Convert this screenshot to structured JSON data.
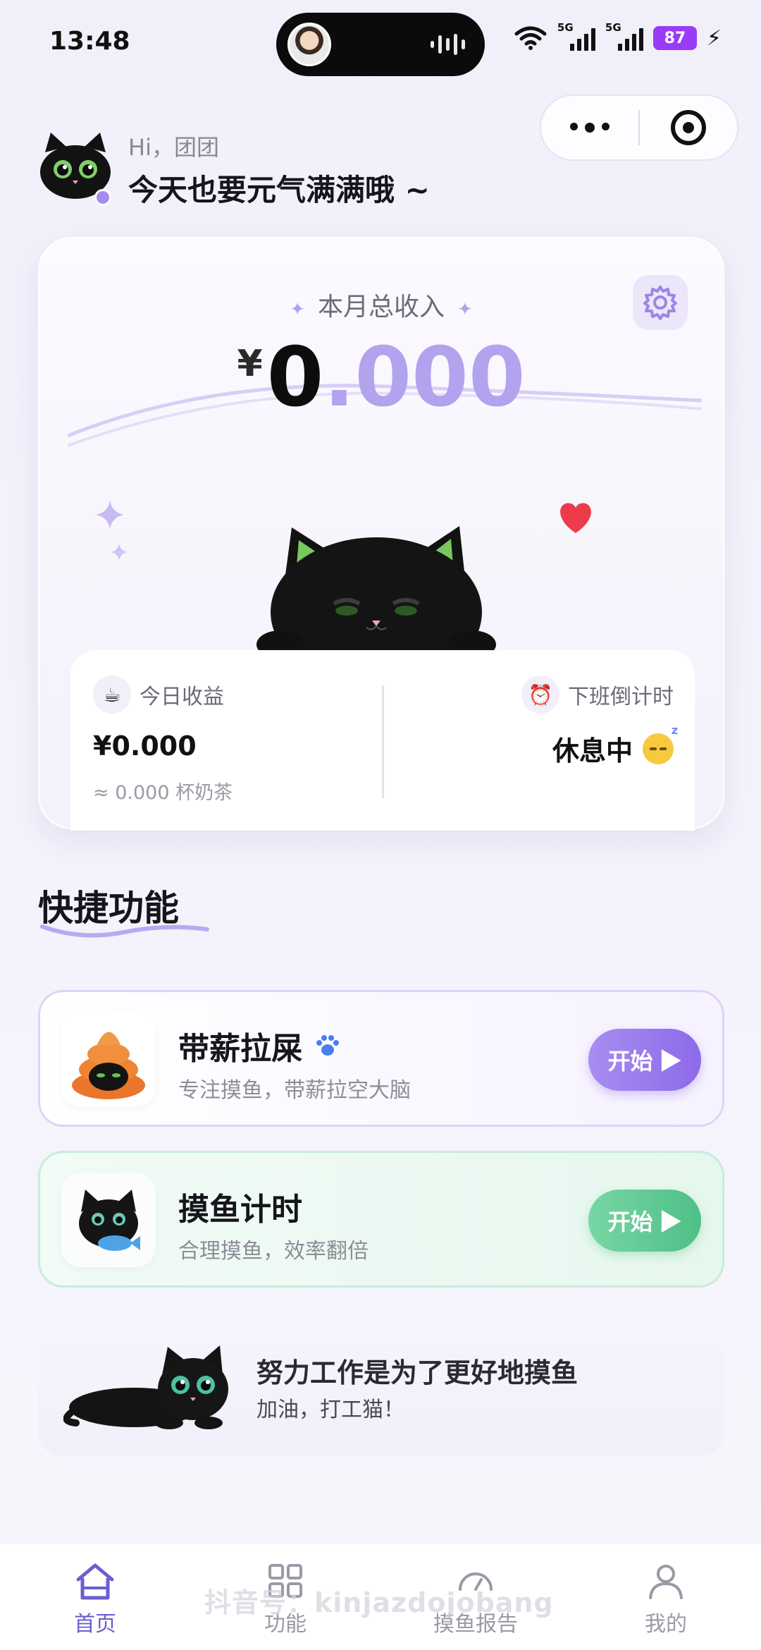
{
  "status_bar": {
    "time": "13:48",
    "network_1": "5G",
    "network_2": "5G",
    "battery": "87"
  },
  "header": {
    "hi": "Hi，团团",
    "greeting": "今天也要元气满满哦 ~"
  },
  "income_card": {
    "label": "本月总收入",
    "currency": "¥",
    "amount_int": "0",
    "amount_dec": ".000",
    "today": {
      "title": "今日收益",
      "amount": "¥0.000",
      "equiv": "≈ 0.000 杯奶茶"
    },
    "countdown": {
      "title": "下班倒计时",
      "status": "休息中"
    }
  },
  "quick": {
    "title": "快捷功能",
    "items": [
      {
        "title": "带薪拉屎",
        "subtitle": "专注摸鱼，带薪拉空大脑",
        "button": "开始 ▶"
      },
      {
        "title": "摸鱼计时",
        "subtitle": "合理摸鱼，效率翻倍",
        "button": "开始 ▶"
      }
    ]
  },
  "motivation": {
    "title": "努力工作是为了更好地摸鱼",
    "subtitle": "加油，打工猫！"
  },
  "nav": {
    "items": [
      {
        "label": "首页"
      },
      {
        "label": "功能"
      },
      {
        "label": "摸鱼报告"
      },
      {
        "label": "我的"
      }
    ]
  },
  "watermark": "抖音号：kinjazdojobang",
  "colors": {
    "accent": "#8d6ae8",
    "accent_light": "#b3a2ee",
    "green": "#4fbf86",
    "nav_active": "#6b5ed0"
  }
}
